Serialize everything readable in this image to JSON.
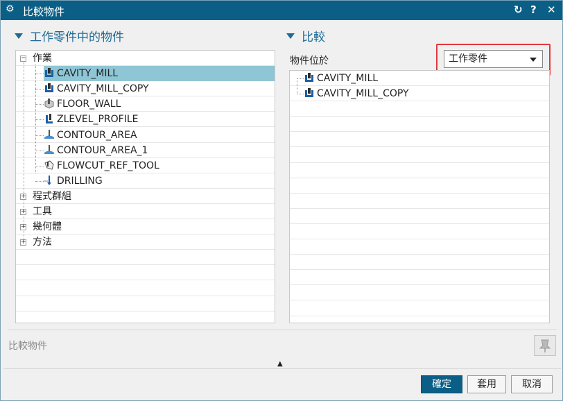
{
  "window": {
    "title": "比較物件",
    "controls": {
      "reset": "↻",
      "help": "?",
      "close": "✕"
    }
  },
  "left_section": {
    "heading": "工作零件中的物件",
    "tree": {
      "root_label": "作業",
      "operations": [
        {
          "label": "CAVITY_MILL",
          "icon": "cavity-mill-icon",
          "selected": true
        },
        {
          "label": "CAVITY_MILL_COPY",
          "icon": "cavity-mill-icon",
          "selected": false
        },
        {
          "label": "FLOOR_WALL",
          "icon": "floor-wall-icon",
          "selected": false
        },
        {
          "label": "ZLEVEL_PROFILE",
          "icon": "zlevel-profile-icon",
          "selected": false
        },
        {
          "label": "CONTOUR_AREA",
          "icon": "contour-area-icon",
          "selected": false
        },
        {
          "label": "CONTOUR_AREA_1",
          "icon": "contour-area-icon",
          "selected": false
        },
        {
          "label": "FLOWCUT_REF_TOOL",
          "icon": "flowcut-icon",
          "selected": false
        },
        {
          "label": "DRILLING",
          "icon": "drilling-icon",
          "selected": false
        }
      ],
      "groups": [
        "程式群組",
        "工具",
        "幾何體",
        "方法"
      ]
    }
  },
  "right_section": {
    "heading": "比較",
    "location_label": "物件位於",
    "location_dropdown": {
      "selected": "工作零件"
    },
    "items": [
      {
        "label": "CAVITY_MILL",
        "icon": "cavity-mill-icon"
      },
      {
        "label": "CAVITY_MILL_COPY",
        "icon": "cavity-mill-icon"
      }
    ]
  },
  "footer": {
    "status_label": "比較物件",
    "collapse_glyph": "▲",
    "buttons": {
      "ok": "確定",
      "apply": "套用",
      "cancel": "取消"
    }
  },
  "colors": {
    "titlebar": "#0b5f86",
    "heading": "#1d6a96",
    "selection": "#8fc6d6",
    "highlight_border": "#e0393e"
  }
}
